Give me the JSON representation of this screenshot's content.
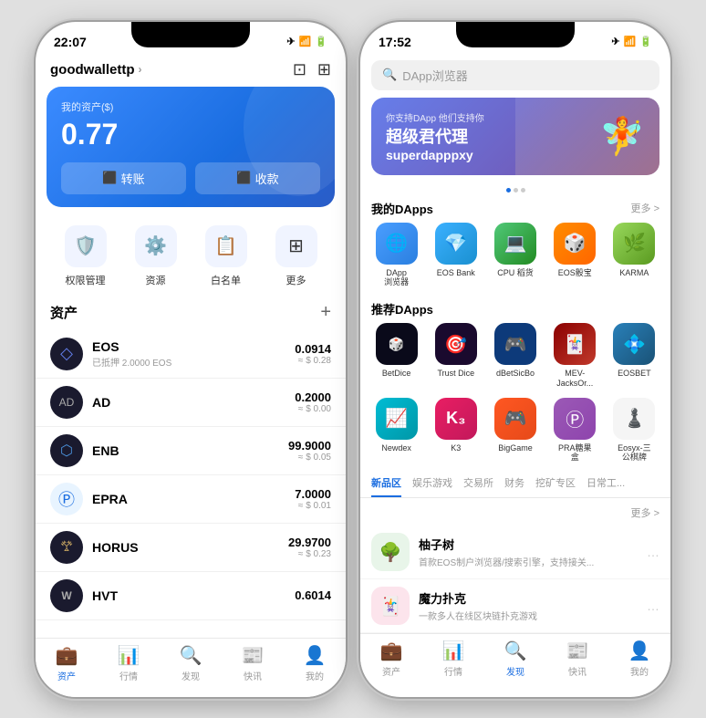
{
  "phone1": {
    "status_time": "22:07",
    "wallet_name": "goodwallettp",
    "balance_label": "我的资产($)",
    "balance_amount": "0.77",
    "action_transfer": "转账",
    "action_receive": "收款",
    "quick_items": [
      {
        "label": "权限管理",
        "icon": "🛡️"
      },
      {
        "label": "资源",
        "icon": "⚙️"
      },
      {
        "label": "白名单",
        "icon": "📋"
      },
      {
        "label": "更多",
        "icon": "⊞"
      }
    ],
    "assets_title": "资产",
    "assets": [
      {
        "name": "EOS",
        "sub": "已抵押 2.0000 EOS",
        "amount": "0.0914",
        "usd": "≈ $ 0.28"
      },
      {
        "name": "AD",
        "sub": "",
        "amount": "0.2000",
        "usd": "≈ $ 0.00"
      },
      {
        "name": "ENB",
        "sub": "",
        "amount": "99.9000",
        "usd": "≈ $ 0.05"
      },
      {
        "name": "EPRA",
        "sub": "",
        "amount": "7.0000",
        "usd": "≈ $ 0.01"
      },
      {
        "name": "HORUS",
        "sub": "",
        "amount": "29.9700",
        "usd": "≈ $ 0.23"
      },
      {
        "name": "HVT",
        "sub": "",
        "amount": "0.6014",
        "usd": ""
      }
    ],
    "nav_items": [
      {
        "label": "资产",
        "active": true
      },
      {
        "label": "行情",
        "active": false
      },
      {
        "label": "发现",
        "active": false
      },
      {
        "label": "快讯",
        "active": false
      },
      {
        "label": "我的",
        "active": false
      }
    ]
  },
  "phone2": {
    "status_time": "17:52",
    "search_placeholder": "DApp浏览器",
    "banner": {
      "sub": "你支持DApp 他们支持你",
      "title": "超级君代理",
      "subtitle": "superdapppxy"
    },
    "my_dapps_title": "我的DApps",
    "my_dapps_more": "更多 >",
    "my_dapps": [
      {
        "label": "DApp\n浏览器",
        "icon_class": "app-dapp",
        "icon": "🌐"
      },
      {
        "label": "EOS Bank",
        "icon_class": "app-eosbank",
        "icon": "💎"
      },
      {
        "label": "CPU 稻货",
        "icon_class": "app-cpu",
        "icon": "💻"
      },
      {
        "label": "EOS骰宝",
        "icon_class": "app-eossebo",
        "icon": "🎲"
      },
      {
        "label": "KARMA",
        "icon_class": "app-karma",
        "icon": "🌿"
      }
    ],
    "recommend_title": "推荐DApps",
    "recommend_dapps_row1": [
      {
        "label": "BetDice",
        "icon_class": "app-betdice",
        "icon": "🎲"
      },
      {
        "label": "Trust Dice",
        "icon_class": "app-trustdice",
        "icon": "🎯"
      },
      {
        "label": "dBetSicBo",
        "icon_class": "app-dbetsicbo",
        "icon": "🎮"
      },
      {
        "label": "MEV-\nJacksOr...",
        "icon_class": "app-mev",
        "icon": "🃏"
      },
      {
        "label": "EOSBET",
        "icon_class": "app-eosbet",
        "icon": "💠"
      }
    ],
    "recommend_dapps_row2": [
      {
        "label": "Newdex",
        "icon_class": "app-newdex",
        "icon": "📈"
      },
      {
        "label": "K3",
        "icon_class": "app-k3",
        "icon": "🎰"
      },
      {
        "label": "BigGame",
        "icon_class": "app-biggame",
        "icon": "🎮"
      },
      {
        "label": "PRA糖果\n盒",
        "icon_class": "app-pra",
        "icon": "🍬"
      },
      {
        "label": "Eosyx-三\n公棋牌",
        "icon_class": "app-eosyx",
        "icon": "♟️"
      }
    ],
    "tabs": [
      {
        "label": "新品区",
        "active": true
      },
      {
        "label": "娱乐游戏",
        "active": false
      },
      {
        "label": "交易所",
        "active": false
      },
      {
        "label": "财务",
        "active": false
      },
      {
        "label": "挖矿专区",
        "active": false
      },
      {
        "label": "日常工...",
        "active": false
      }
    ],
    "new_more": "更多 >",
    "new_apps": [
      {
        "name": "柚子树",
        "desc": "首款EOS制户浏览器/搜索引擎，支持接关...",
        "icon": "🌳",
        "icon_bg": "#e8f5e9"
      },
      {
        "name": "魔力扑克",
        "desc": "一款多人在线区块链扑克游戏",
        "icon": "🃏",
        "icon_bg": "#fce4ec"
      }
    ],
    "nav_items": [
      {
        "label": "资产",
        "active": false
      },
      {
        "label": "行情",
        "active": false
      },
      {
        "label": "发现",
        "active": true
      },
      {
        "label": "快讯",
        "active": false
      },
      {
        "label": "我的",
        "active": false
      }
    ]
  }
}
